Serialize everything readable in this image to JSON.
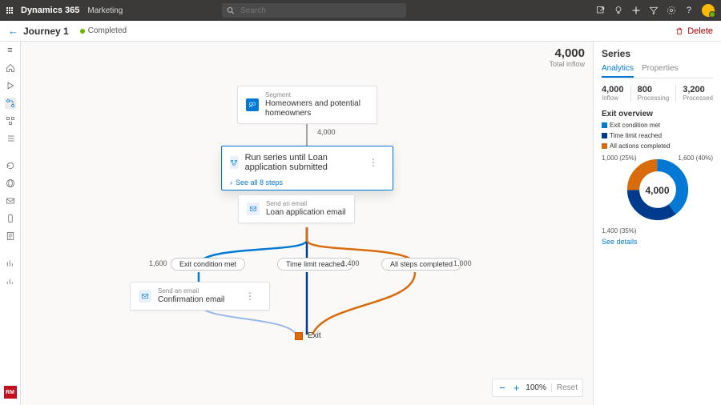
{
  "topbar": {
    "product": "Dynamics 365",
    "module": "Marketing",
    "search_placeholder": "Search"
  },
  "cmd": {
    "title": "Journey 1",
    "status": "Completed",
    "delete": "Delete"
  },
  "leftnav": {
    "persona": "RM"
  },
  "inflow": {
    "value": "4,000",
    "label": "Total inflow"
  },
  "flow": {
    "segment": {
      "type": "Segment",
      "name": "Homeowners and potential homeowners"
    },
    "seg_out": "4,000",
    "series": {
      "type": "Run series until",
      "name": "Loan application submitted",
      "see_all": "See all 8 steps",
      "step": {
        "type": "Send an email",
        "name": "Loan application email"
      }
    },
    "tags": {
      "exit": "Exit condition met",
      "time": "Time limit reached",
      "all": "All steps completed"
    },
    "counts": {
      "exit": "1,600",
      "time": "1,400",
      "all": "1,000"
    },
    "confirm": {
      "type": "Send an email",
      "name": "Confirmation email"
    },
    "exit": "Exit"
  },
  "zoom": {
    "value": "100%",
    "reset": "Reset"
  },
  "rp": {
    "title": "Series",
    "tabs": {
      "analytics": "Analytics",
      "properties": "Properties"
    },
    "kpis": [
      {
        "num": "4,000",
        "lab": "Inflow"
      },
      {
        "num": "800",
        "lab": "Processing"
      },
      {
        "num": "3,200",
        "lab": "Processed"
      }
    ],
    "overview": "Exit overview",
    "legend": {
      "exit": "Exit condition met",
      "time": "Time limit reached",
      "all": "All actions completed"
    },
    "donut": {
      "total": "4,000",
      "exit": "1,000 (25%)",
      "all": "1,600 (40%)",
      "time": "1,400 (35%)"
    },
    "see": "See details"
  },
  "chart_data": {
    "type": "pie",
    "title": "Exit overview",
    "series": [
      {
        "name": "Exit condition met",
        "value": 1000,
        "pct": 25,
        "color": "#0078d4"
      },
      {
        "name": "All actions completed",
        "value": 1600,
        "pct": 40,
        "color": "#d86b0c"
      },
      {
        "name": "Time limit reached",
        "value": 1400,
        "pct": 35,
        "color": "#003a8c"
      }
    ],
    "total": 4000
  }
}
